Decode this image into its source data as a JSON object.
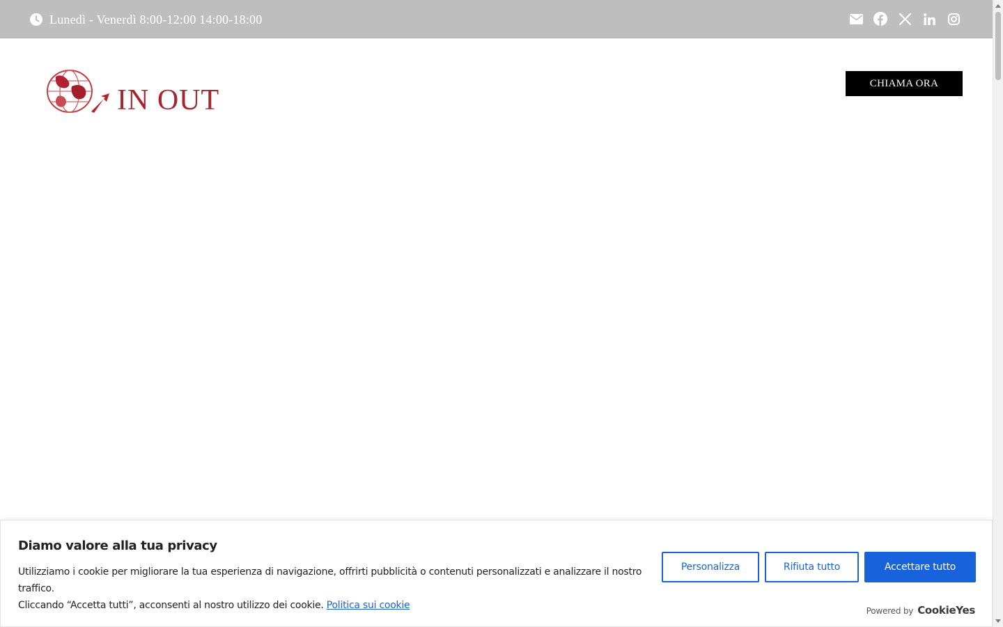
{
  "topbar": {
    "hours_text": "Lunedì - Venerdì 8:00-12:00 14:00-18:00",
    "background": "#bebebe",
    "social_icons": [
      "email-icon",
      "facebook-icon",
      "x-icon",
      "linkedin-icon",
      "instagram-icon"
    ]
  },
  "header": {
    "logo_text": "IN  OUT",
    "cta_label": "CHIAMA ORA"
  },
  "cookie_banner": {
    "title": "Diamo valore alla tua privacy",
    "body_line1": "Utilizziamo i cookie per migliorare la tua esperienza di navigazione, offrirti pubblicità o contenuti personalizzati e analizzare il nostro traffico.",
    "body_line2": "Cliccando “Accetta tutti”, acconsenti al nostro utilizzo dei cookie.",
    "policy_link": "Politica sui cookie",
    "customize_label": "Personalizza",
    "reject_label": "Rifiuta tutto",
    "accept_label": "Accettare tutto",
    "powered_by": "Powered by",
    "powered_brand": "CookieYes",
    "accent_color": "#1863dc"
  },
  "colors": {
    "brand_red": "#a8242f",
    "cta_background": "#000000"
  }
}
